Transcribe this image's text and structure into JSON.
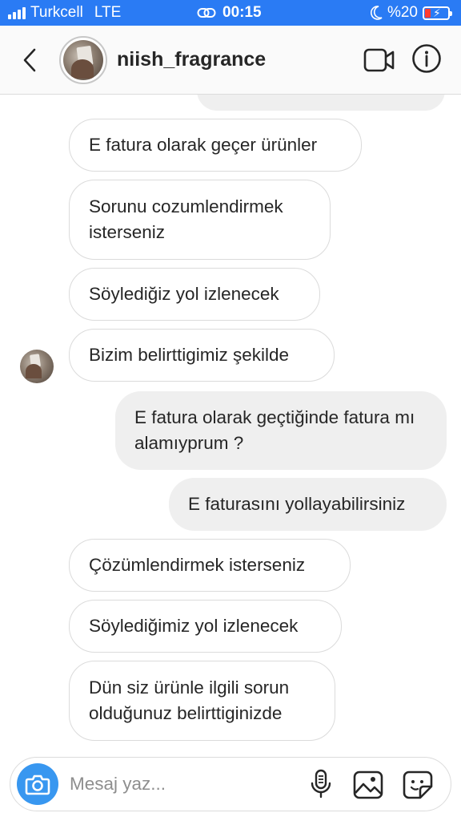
{
  "status_bar": {
    "carrier": "Turkcell",
    "network": "LTE",
    "time": "00:15",
    "battery": "%20"
  },
  "header": {
    "username": "niish_fragrance"
  },
  "messages": [
    {
      "type": "received",
      "text": "E fatura olarak geçer ürünler"
    },
    {
      "type": "received",
      "text": "Sorunu cozumlendirmek isterseniz"
    },
    {
      "type": "received",
      "text": "Söylediğiz yol izlenecek"
    },
    {
      "type": "received",
      "text": "Bizim belirttigimiz şekilde"
    },
    {
      "type": "sent",
      "text": "E fatura olarak geçtiğinde fatura mı alamıyprum ?"
    },
    {
      "type": "sent",
      "text": "E faturasını yollayabilirsiniz"
    },
    {
      "type": "received",
      "text": "Çözümlendirmek isterseniz"
    },
    {
      "type": "received",
      "text": "Söylediğimiz yol izlenecek"
    },
    {
      "type": "received",
      "text": "Dün siz ürünle ilgili sorun olduğunuz belirttiginizde"
    }
  ],
  "composer": {
    "placeholder": "Mesaj yaz..."
  },
  "colors": {
    "status_bar_bg": "#2a7bf4",
    "camera_button": "#3897f0",
    "sent_bubble": "#efefef",
    "received_border": "#dbdbdb",
    "battery_low": "#ff3b30"
  },
  "icons": [
    "signal-icon",
    "link-icon",
    "moon-icon",
    "battery-icon",
    "back-icon",
    "video-call-icon",
    "info-icon",
    "camera-icon",
    "microphone-icon",
    "gallery-icon",
    "sticker-icon"
  ]
}
